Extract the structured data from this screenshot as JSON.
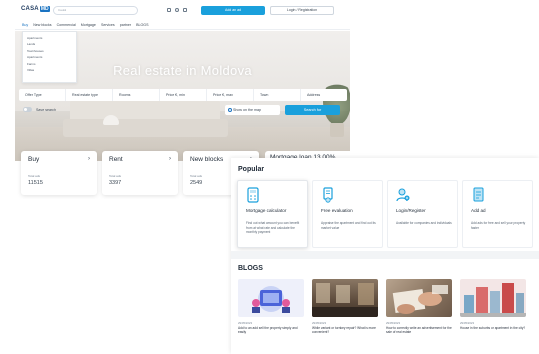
{
  "header": {
    "logo_main": "CASA",
    "logo_suffix": "MD",
    "search_placeholder": "Caută",
    "add_ad_label": "Add an ad",
    "login_label": "Login / Registration"
  },
  "nav": {
    "items": [
      "Buy",
      "New blocks",
      "Commercial",
      "Mortgage",
      "Services",
      "partner",
      "BLOGS"
    ]
  },
  "dropdown": {
    "items": [
      "Apartments",
      "Lands",
      "Townhouses",
      "Apartments",
      "Farms",
      "Villas"
    ]
  },
  "hero": {
    "title": "Real estate in Moldova"
  },
  "filters": {
    "items": [
      "Offer Type",
      "Real estate type",
      "Rooms",
      "Price €, min",
      "Price €, max",
      "Town",
      "Address"
    ]
  },
  "controls": {
    "save_search_label": "Save search",
    "map_label": "Show on the map",
    "search_label": "Search for"
  },
  "categories": [
    {
      "title": "Buy",
      "sub": "Total ads",
      "count": "11515"
    },
    {
      "title": "Rent",
      "sub": "Total ads",
      "count": "3397"
    },
    {
      "title": "New blocks",
      "sub": "Total ads",
      "count": "2549"
    }
  ],
  "mortgage_card": {
    "title": "Mortgage loan 13.00%"
  },
  "popular": {
    "title": "Popular",
    "cards": [
      {
        "icon": "calculator-icon",
        "title": "Mortgage calculator",
        "desc": "Find out what amount you can benefit from at what rate and calculate the monthly payment"
      },
      {
        "icon": "evaluation-icon",
        "title": "Free evaluation",
        "desc": "Appraise the apartment and find out its market value"
      },
      {
        "icon": "user-add-icon",
        "title": "Login/Register",
        "desc": "Available for companies and individuals"
      },
      {
        "icon": "document-icon",
        "title": "Add ad",
        "desc": "Add ads for free and sell your property faster"
      }
    ]
  },
  "blogs": {
    "title": "BLOGS",
    "posts": [
      {
        "image": "illustration-icon",
        "date": "29/05/2023",
        "text": "Add to an add sell the property simply and easily"
      },
      {
        "image": "interior-photo",
        "date": "29/05/2023",
        "text": "While variant or turnkey repair? What is more convenient?"
      },
      {
        "image": "hands-photo",
        "date": "29/05/2023",
        "text": "How to correctly write an advertisement for the sale of real estate"
      },
      {
        "image": "city-photo",
        "date": "29/05/2023",
        "text": "House in the suburbs or apartment in the city?"
      }
    ]
  },
  "colors": {
    "accent": "#1aa0dc",
    "brand": "#1a73c2",
    "text": "#1f2a37"
  }
}
